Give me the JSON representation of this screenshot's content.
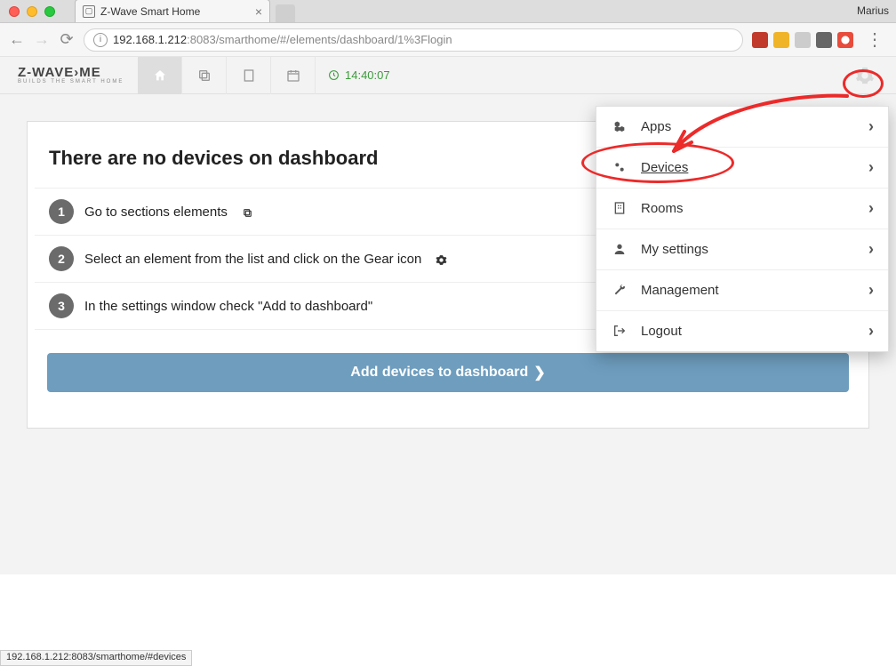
{
  "browser": {
    "profile": "Marius",
    "tab_title": "Z-Wave Smart Home",
    "url_host": "192.168.1.212",
    "url_port": ":8083",
    "url_path": "/smarthome/#/elements/dashboard/1%3Flogin",
    "status_url": "192.168.1.212:8083/smarthome/#devices"
  },
  "header": {
    "logo_main": "Z-WAVE›ME",
    "logo_sub": "BUILDS THE SMART HOME",
    "clock": "14:40:07"
  },
  "dropdown": {
    "items": [
      {
        "label": "Apps"
      },
      {
        "label": "Devices"
      },
      {
        "label": "Rooms"
      },
      {
        "label": "My settings"
      },
      {
        "label": "Management"
      },
      {
        "label": "Logout"
      }
    ]
  },
  "empty": {
    "title": "There are no devices on dashboard",
    "steps": [
      "Go to sections elements",
      "Select an element from the list and click on the Gear icon",
      "In the settings window check \"Add to dashboard\""
    ],
    "button": "Add devices to dashboard"
  }
}
